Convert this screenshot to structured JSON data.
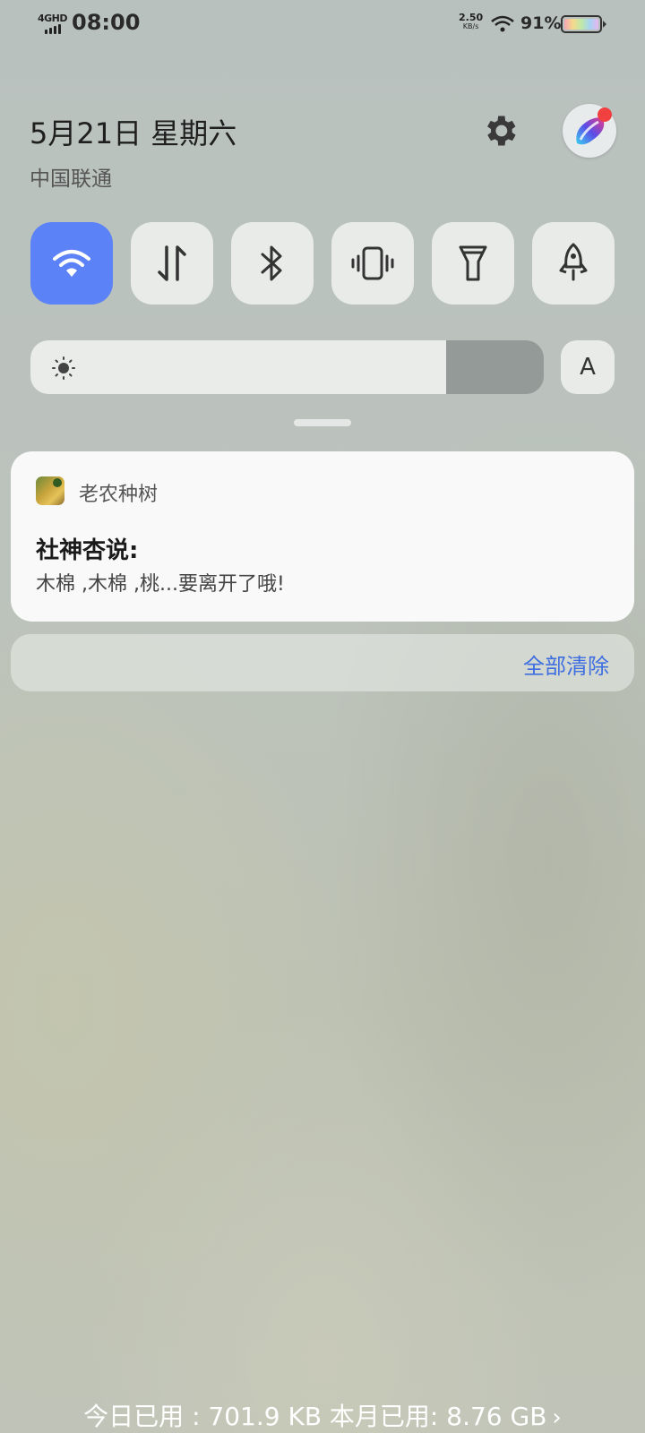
{
  "status_bar": {
    "network": "4GHD",
    "time": "08:00",
    "speed_value": "2.50",
    "speed_unit": "KB/s",
    "battery": "91%"
  },
  "header": {
    "date": "5月21日 星期六",
    "carrier": "中国联通",
    "settings_icon": "gear-icon"
  },
  "quick_tiles": [
    {
      "name": "wifi",
      "icon": "wifi-icon",
      "active": true
    },
    {
      "name": "mobile-data",
      "icon": "data-arrows-icon",
      "active": false
    },
    {
      "name": "bluetooth",
      "icon": "bluetooth-icon",
      "active": false
    },
    {
      "name": "vibrate",
      "icon": "vibrate-icon",
      "active": false
    },
    {
      "name": "flashlight",
      "icon": "flashlight-icon",
      "active": false
    },
    {
      "name": "airplane-rocket",
      "icon": "rocket-icon",
      "active": false
    }
  ],
  "brightness": {
    "level": 0.81,
    "auto_label": "A"
  },
  "notification": {
    "app_name": "老农种树",
    "title": "社神杏说:",
    "body": "木棉 ,木棉 ,桃...要离开了哦!"
  },
  "clear_all": "全部清除",
  "data_usage": "今日已用 : 701.9 KB 本月已用: 8.76 GB",
  "data_usage_chevron": "›",
  "colors": {
    "accent": "#5b82f7",
    "link": "#3e6ee0"
  }
}
